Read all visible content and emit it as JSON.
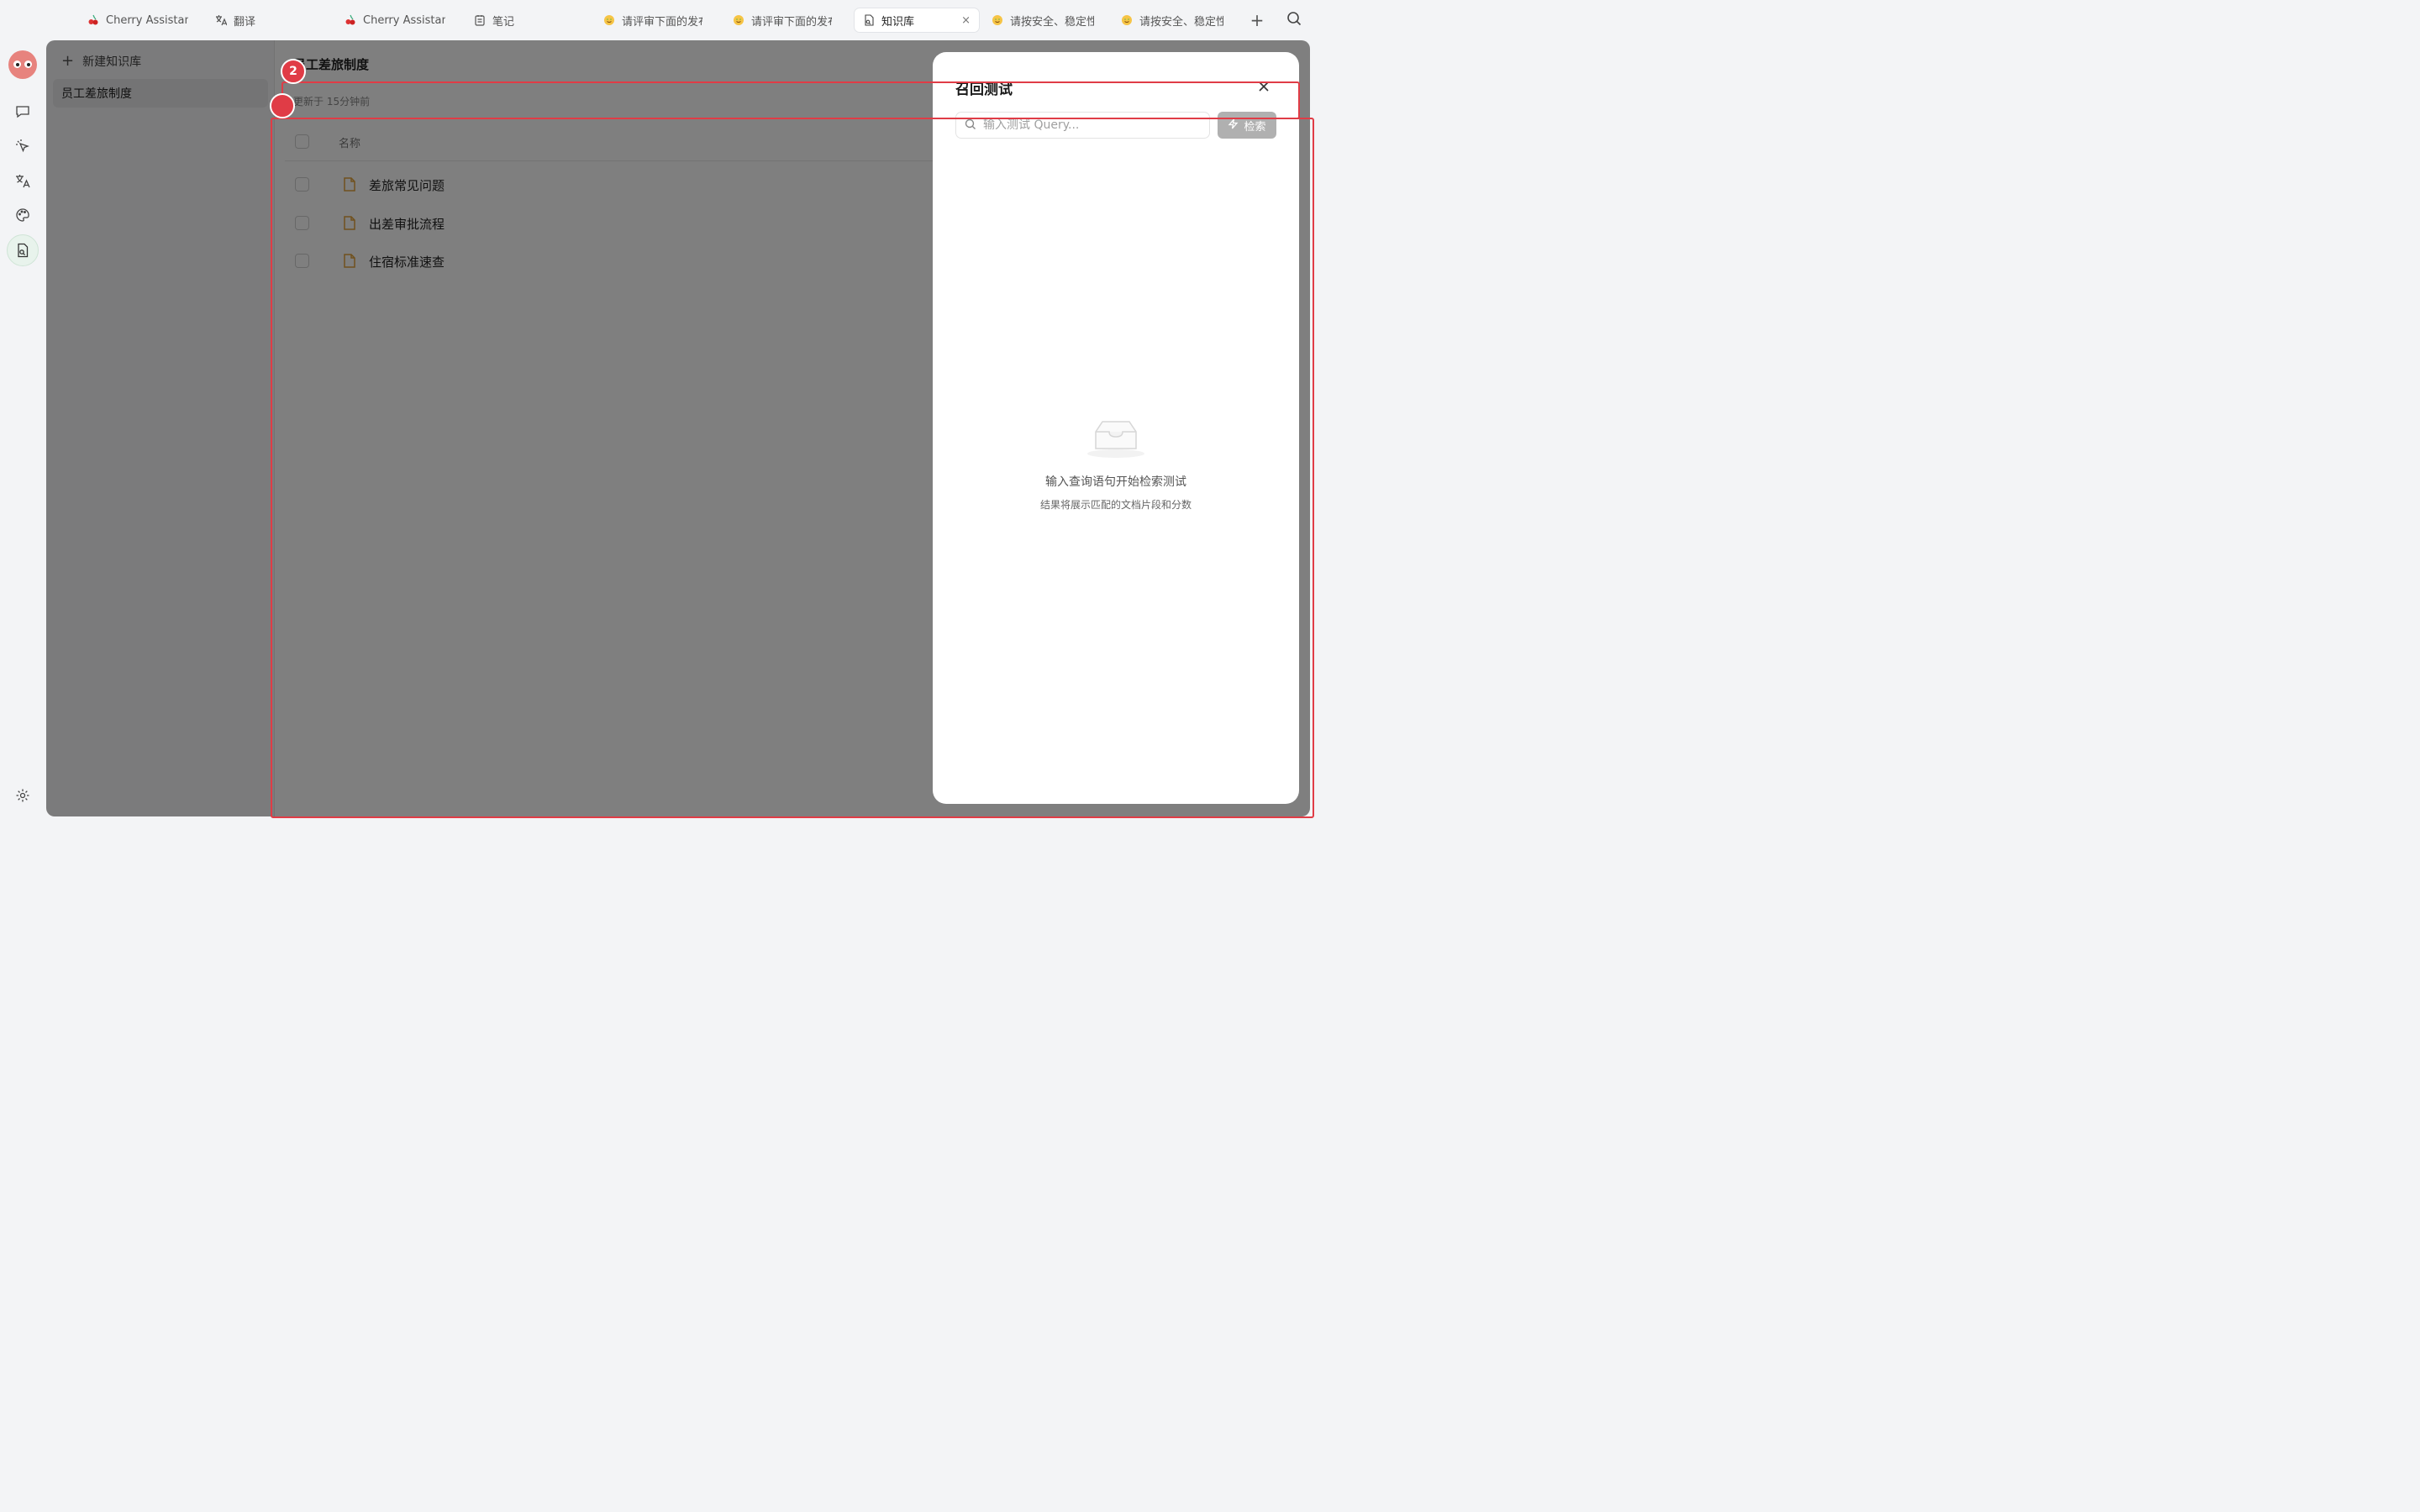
{
  "tabs": [
    {
      "label": "Cherry Assistant",
      "icon": "cherry-icon"
    },
    {
      "label": "翻译",
      "icon": "translate-icon"
    },
    {
      "label": "Cherry Assistant",
      "icon": "cherry-icon"
    },
    {
      "label": "笔记",
      "icon": "notes-icon"
    },
    {
      "label": "请评审下面的发布",
      "icon": "smile-emoji-icon"
    },
    {
      "label": "请评审下面的发布",
      "icon": "smile-emoji-icon"
    },
    {
      "label": "知识库",
      "icon": "knowledge-icon",
      "active": true
    },
    {
      "label": "请按安全、稳定性",
      "icon": "smile-emoji-icon"
    },
    {
      "label": "请按安全、稳定性",
      "icon": "smile-emoji-icon"
    }
  ],
  "kb_sidebar": {
    "new_label": "新建知识库",
    "items": [
      {
        "label": "员工差旅制度",
        "selected": true
      }
    ]
  },
  "kb": {
    "title": "员工差旅制度",
    "updated": "更新于 15分钟前",
    "column_name": "名称",
    "files": [
      "差旅常见问题",
      "出差审批流程",
      "住宿标准速查"
    ]
  },
  "drawer": {
    "title": "召回测试",
    "search_placeholder": "输入测试 Query...",
    "search_button": "检索",
    "empty_title": "输入查询语句开始检索测试",
    "empty_subtitle": "结果将展示匹配的文档片段和分数"
  },
  "annotations": [
    "2"
  ],
  "colors": {
    "annotation": "#e03c46",
    "file_icon": "#e0a23a",
    "accent_green": "#2e8b57"
  }
}
